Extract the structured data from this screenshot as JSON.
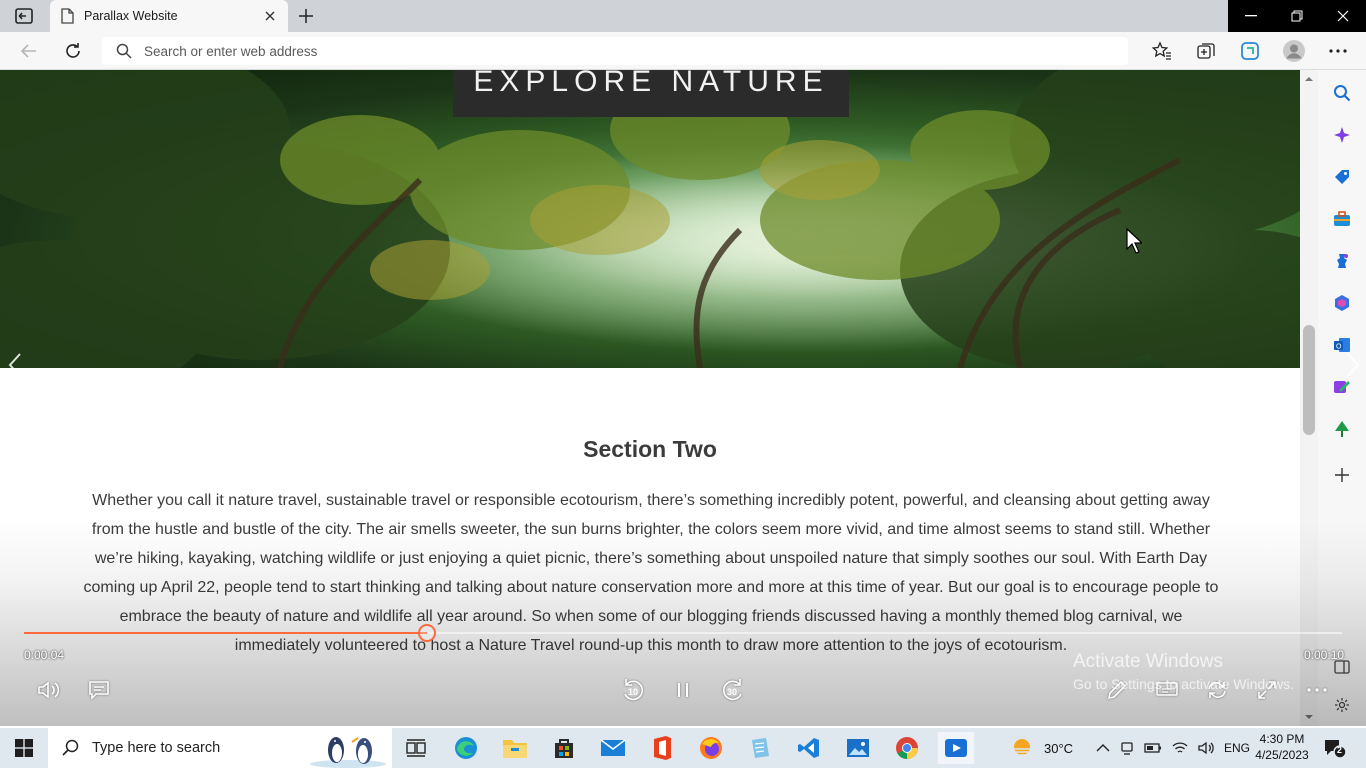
{
  "browser": {
    "tab_title": "Parallax Website",
    "address_placeholder": "Search or enter web address"
  },
  "page": {
    "hero_title": "EXPLORE NATURE",
    "section_title": "Section Two",
    "section_body": "Whether you call it nature travel, sustainable travel or responsible ecotourism, there’s something incredibly potent, powerful, and cleansing about getting away from the hustle and bustle of the city. The air smells sweeter, the sun burns brighter, the colors seem more vivid, and time almost seems to stand still. Whether we’re hiking, kayaking, watching wildlife or just enjoying a quiet picnic, there’s something about unspoiled nature that simply soothes our soul. With Earth Day coming up April 22, people tend to start thinking and talking about nature conservation more and more at this time of year. But our goal is to encourage people to embrace the beauty of nature and wildlife all year around. So when some of our blogging friends discussed having a monthly themed blog carnival, we immediately volunteered to host a Nature Travel round-up this month to draw more attention to the joys of ecotourism."
  },
  "player": {
    "current_time": "0:00:04",
    "total_time": "0:00:10",
    "progress": 0.306,
    "accent_color": "#ff6a3d",
    "skip_back_label": "10",
    "skip_forward_label": "30"
  },
  "watermark": {
    "line1": "Activate Windows",
    "line2": "Go to Settings to activate Windows."
  },
  "taskbar": {
    "search_placeholder": "Type here to search",
    "weather": "30°C",
    "language": "ENG",
    "time": "4:30 PM",
    "date": "4/25/2023",
    "notification_count": "2",
    "apps": [
      "task-view",
      "edge",
      "file-explorer",
      "microsoft-store",
      "mail",
      "office",
      "firefox",
      "notepad",
      "vscode",
      "photos",
      "chrome",
      "media-player"
    ]
  }
}
